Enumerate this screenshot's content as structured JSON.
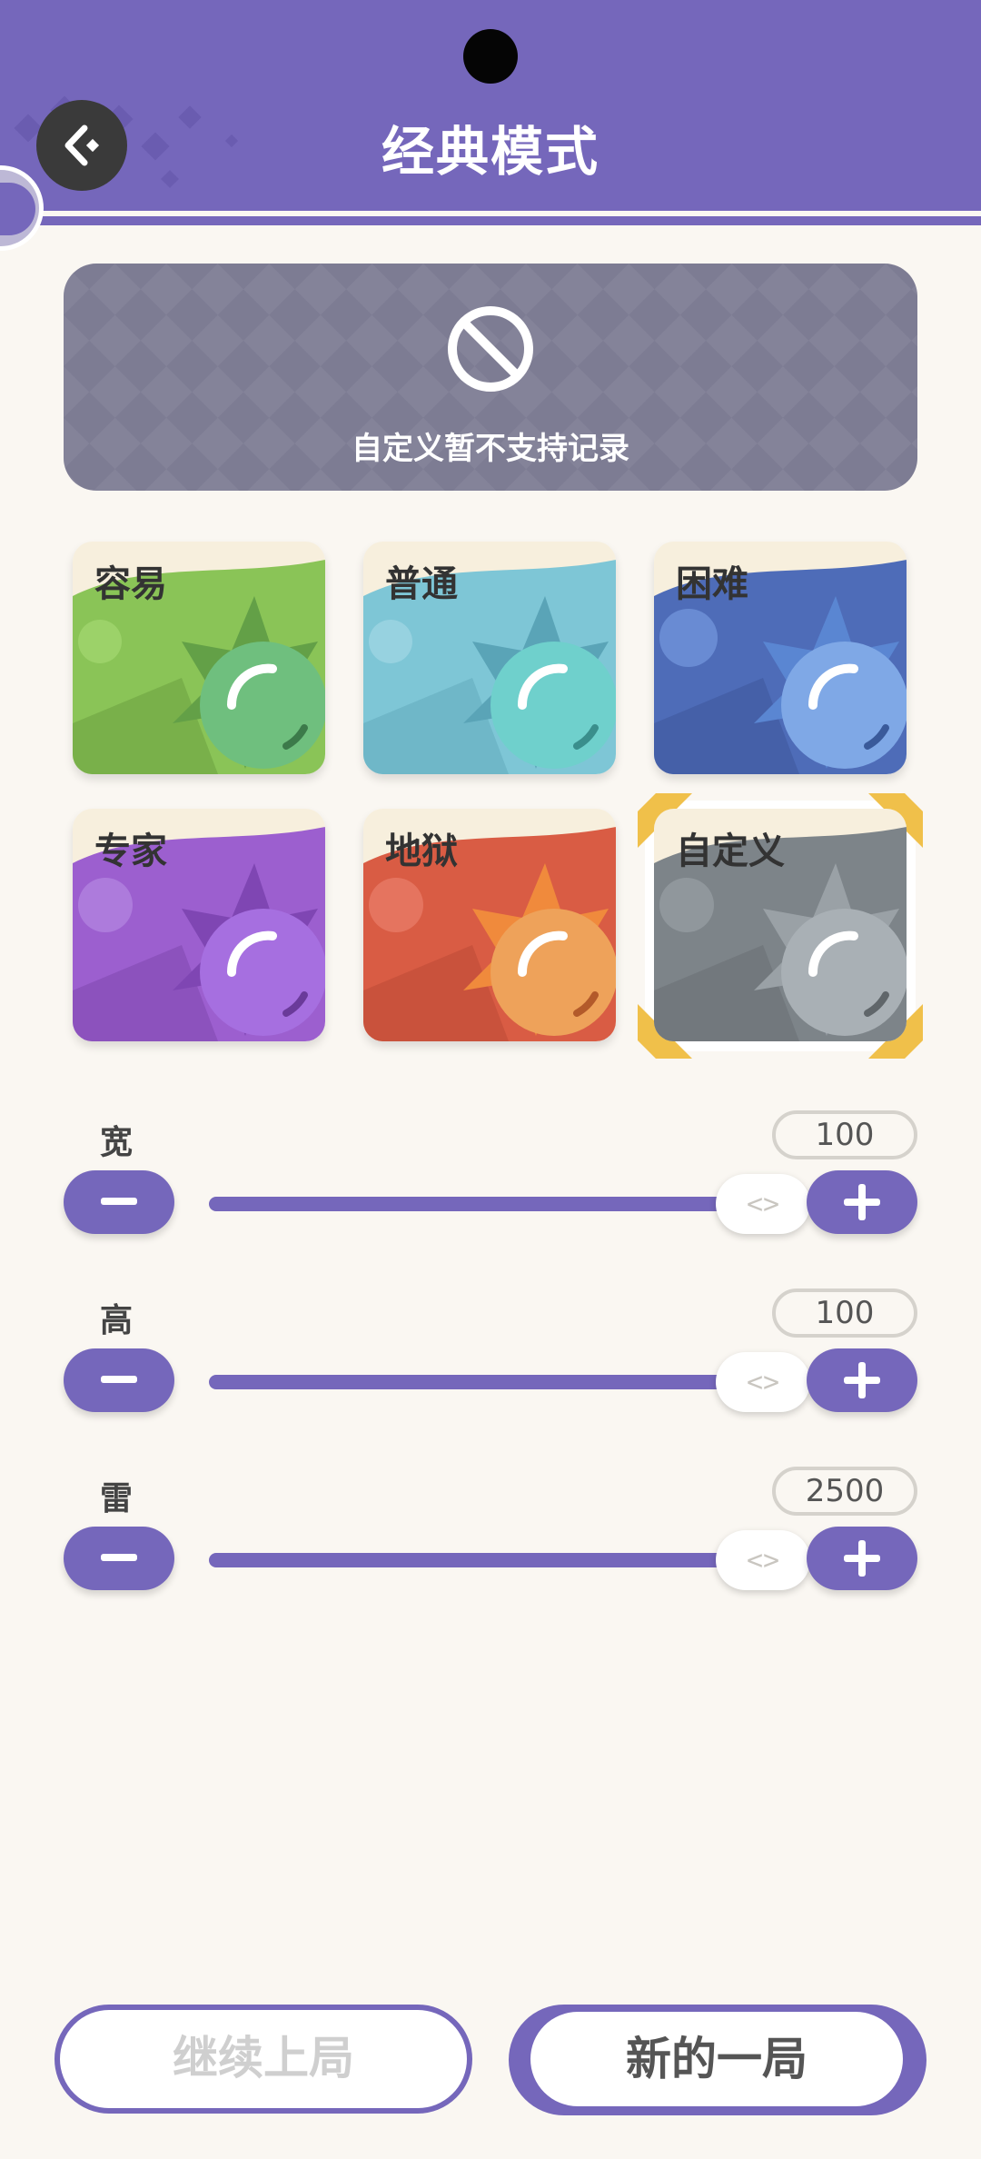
{
  "header": {
    "title": "经典模式",
    "back_icon": "back-arrow-icon",
    "background": "#7567bb"
  },
  "notice": {
    "icon": "ban-icon",
    "text": "自定义暂不支持记录"
  },
  "difficulties": [
    {
      "label": "容易",
      "theme": "#8ac457",
      "accent": "#6fbf7e",
      "selected": false
    },
    {
      "label": "普通",
      "theme": "#7ec6d6",
      "accent": "#6fd0cc",
      "selected": false
    },
    {
      "label": "困难",
      "theme": "#4e6cb8",
      "accent": "#7fa8e6",
      "selected": false
    },
    {
      "label": "专家",
      "theme": "#9c5fcf",
      "accent": "#a66fe0",
      "selected": false
    },
    {
      "label": "地狱",
      "theme": "#d95c44",
      "accent": "#eea25a",
      "selected": false
    },
    {
      "label": "自定义",
      "theme": "#7d8489",
      "accent": "#a9b0b5",
      "selected": true
    }
  ],
  "settings": {
    "width": {
      "label": "宽",
      "value": "100"
    },
    "height": {
      "label": "高",
      "value": "100"
    },
    "mines": {
      "label": "雷",
      "value": "2500"
    },
    "minus_icon": "minus-icon",
    "plus_icon": "plus-icon",
    "thumb_icon": "drag-handle-icon",
    "thumb_glyph": "<>"
  },
  "buttons": {
    "continue_label": "继续上局",
    "new_game_label": "新的一局"
  },
  "colors": {
    "accent": "#7567bb",
    "background": "#faf7f2",
    "selected_corner": "#f0c04a"
  }
}
